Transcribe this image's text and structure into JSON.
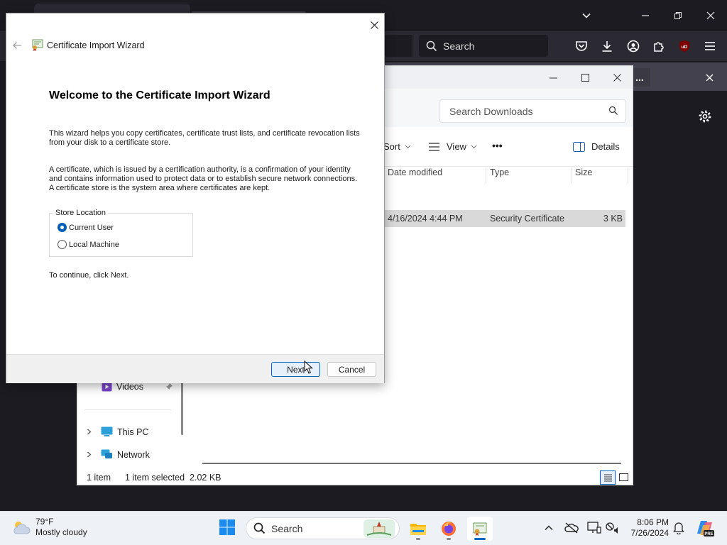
{
  "browser": {
    "search_placeholder": "Search",
    "notification_dots": "...",
    "badge": "uD"
  },
  "explorer": {
    "search_placeholder": "Search Downloads",
    "toolbar": {
      "sort": "Sort",
      "view": "View",
      "more": "•••",
      "details": "Details"
    },
    "columns": {
      "date": "Date modified",
      "type": "Type",
      "size": "Size"
    },
    "file": {
      "date": "4/16/2024 4:44 PM",
      "type": "Security Certificate",
      "size": "3 KB"
    },
    "nav": {
      "videos": "Videos",
      "this_pc": "This PC",
      "network": "Network"
    },
    "status": {
      "count": "1 item",
      "selected": "1 item selected  2.02 KB"
    }
  },
  "wizard": {
    "title": "Certificate Import Wizard",
    "heading": "Welcome to the Certificate Import Wizard",
    "para1": "This wizard helps you copy certificates, certificate trust lists, and certificate revocation lists from your disk to a certificate store.",
    "para2": "A certificate, which is issued by a certification authority, is a confirmation of your identity and contains information used to protect data or to establish secure network connections. A certificate store is the system area where certificates are kept.",
    "store_location": "Store Location",
    "options": [
      "Current User",
      "Local Machine"
    ],
    "selected_option": "Current User",
    "continue_text": "To continue, click Next.",
    "next": "Next",
    "cancel": "Cancel"
  },
  "taskbar": {
    "temperature": "79°F",
    "weather": "Mostly cloudy",
    "search": "Search",
    "time": "8:06 PM",
    "date": "7/26/2024",
    "copilot_badge": "PRE"
  },
  "icons": {
    "browser": [
      "list-all-tabs-icon",
      "search-icon",
      "pocket-icon",
      "download-icon",
      "account-icon",
      "extensions-icon",
      "ublock-icon",
      "menu-icon",
      "settings-gear-icon"
    ],
    "explorer": [
      "search-icon",
      "sort-icon",
      "view-icon",
      "details-pane-icon",
      "videos-icon",
      "pin-icon",
      "this-pc-icon",
      "network-icon"
    ],
    "wizard": [
      "back-arrow-icon",
      "certificate-icon",
      "close-icon"
    ],
    "taskbar": [
      "weather-cloud-icon",
      "windows-start-icon",
      "file-explorer-icon",
      "firefox-icon",
      "certificate-app-icon",
      "chevron-up-icon",
      "onedrive-offline-icon",
      "display-icon",
      "network-volume-icon",
      "notification-bell-icon",
      "copilot-icon"
    ]
  },
  "colors": {
    "accent": "#0067c0",
    "browser_bg": "#1c1b22",
    "selected_row": "#d9d9d9"
  }
}
